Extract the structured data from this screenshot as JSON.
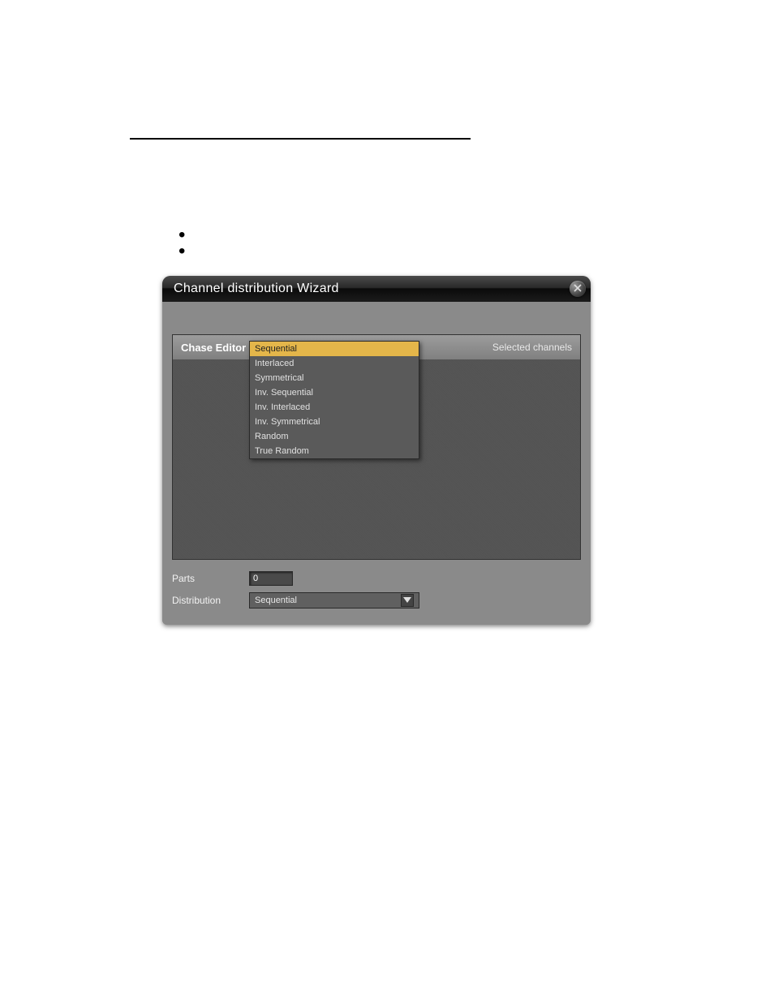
{
  "window": {
    "title": "Channel distribution Wizard"
  },
  "panel": {
    "title_left": "Chase Editor",
    "title_right": "Selected channels"
  },
  "form": {
    "parts_label": "Parts",
    "parts_value": "0",
    "distribution_label": "Distribution",
    "distribution_selected": "Sequential",
    "distribution_options": [
      "Sequential",
      "Interlaced",
      "Symmetrical",
      "Inv. Sequential",
      "Inv. Interlaced",
      "Inv. Symmetrical",
      "Random",
      "True Random"
    ]
  }
}
